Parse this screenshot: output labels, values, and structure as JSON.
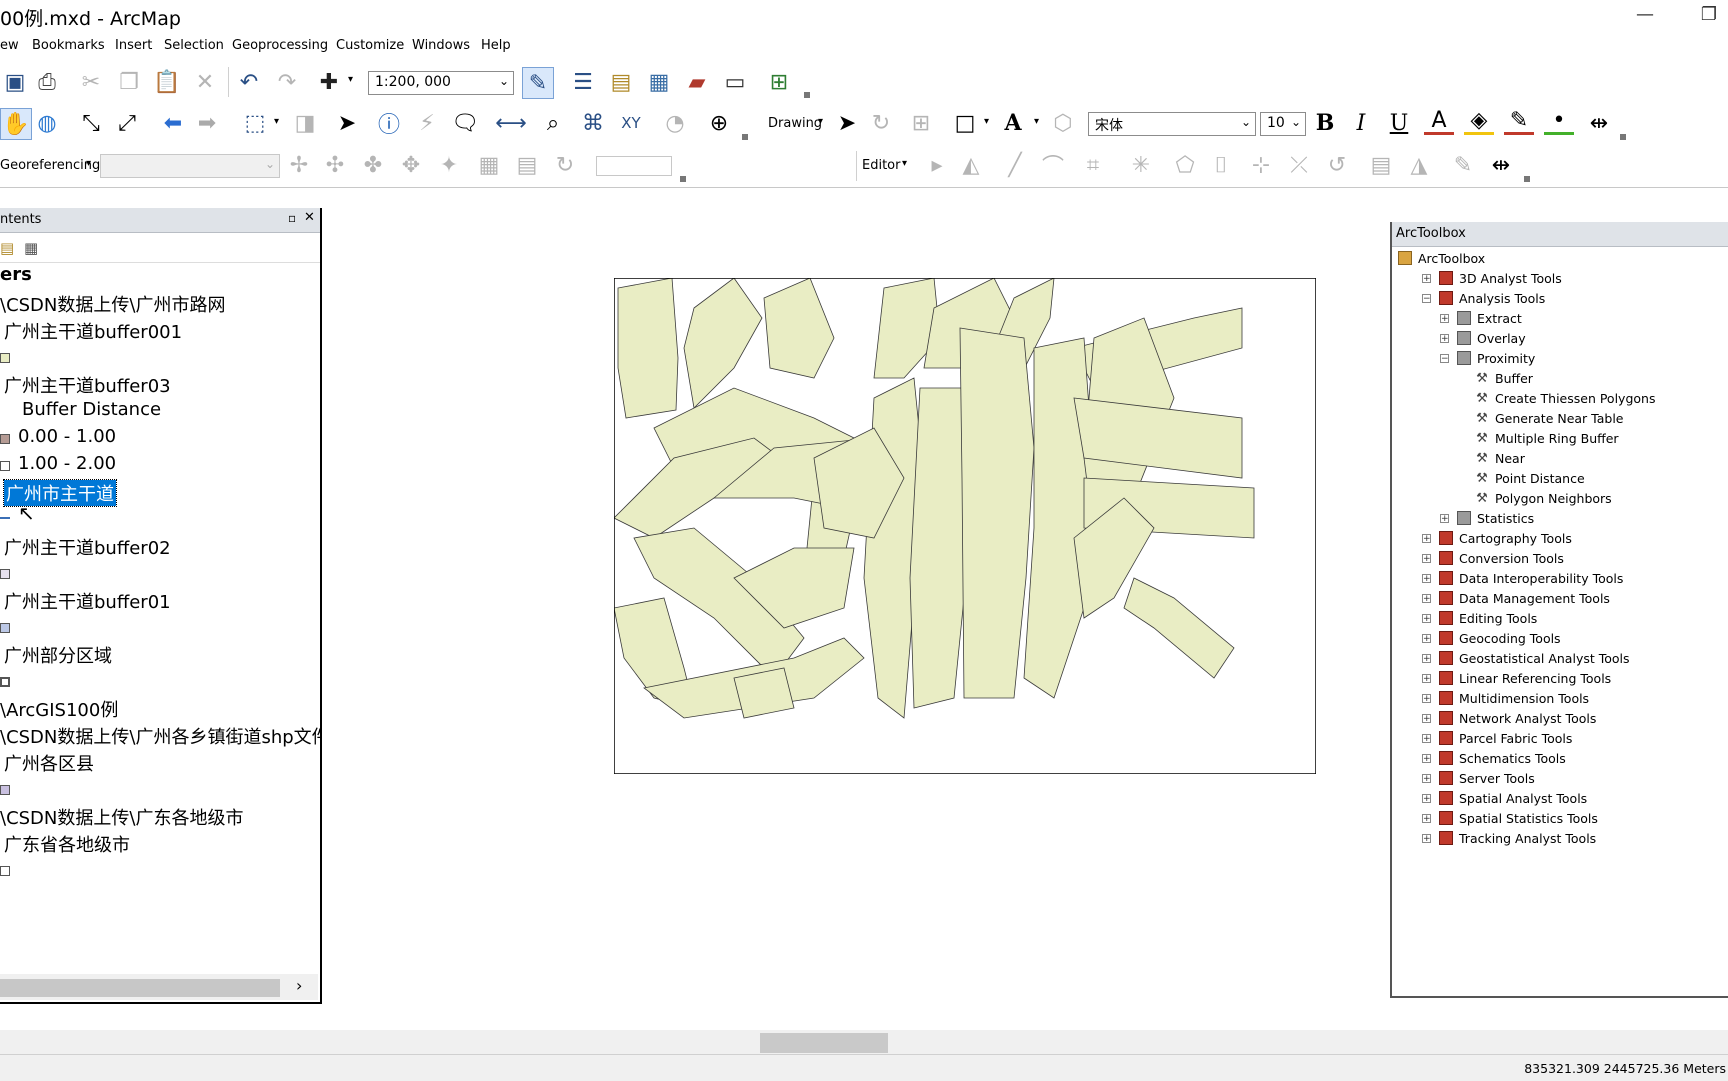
{
  "window": {
    "title": "00例.mxd - ArcMap",
    "minimize_glyph": "—",
    "restore_glyph": "❐"
  },
  "menu": [
    "ew",
    "Bookmarks",
    "Insert",
    "Selection",
    "Geoprocessing",
    "Customize",
    "Windows",
    "Help"
  ],
  "standard_toolbar": {
    "scale": "1:200, 000"
  },
  "draw_toolbar": {
    "drawing_label": "Drawing",
    "font_name": "宋体",
    "font_size": "10",
    "bold": "B",
    "italic": "I",
    "underline": "U"
  },
  "georef_toolbar": {
    "label": "Georeferencing",
    "editor_label": "Editor"
  },
  "toc": {
    "title": "ntents",
    "lines": [
      {
        "kind": "text",
        "text": "ers",
        "bold": true
      },
      {
        "kind": "text",
        "text": "\\CSDN数据上传\\广州市路网"
      },
      {
        "kind": "text",
        "text": "广州主干道buffer001",
        "indent": true
      },
      {
        "kind": "swatch",
        "color": "#e9edc4"
      },
      {
        "kind": "text",
        "text": "广州主干道buffer03",
        "indent": true
      },
      {
        "kind": "text",
        "text": "Buffer Distance",
        "indent2": true
      },
      {
        "kind": "legend",
        "text": "0.00 - 1.00",
        "color": "#b59b94"
      },
      {
        "kind": "legend",
        "text": "1.00 - 2.00",
        "color": "#ffffff"
      },
      {
        "kind": "selected",
        "text": "广州市主干道"
      },
      {
        "kind": "line",
        "color": "#3b6fb6"
      },
      {
        "kind": "text",
        "text": "广州主干道buffer02",
        "indent": true
      },
      {
        "kind": "swatch",
        "color": "#e7e1ef"
      },
      {
        "kind": "text",
        "text": "广州主干道buffer01",
        "indent": true
      },
      {
        "kind": "swatch",
        "color": "#bcc8e6"
      },
      {
        "kind": "text",
        "text": "广州部分区域",
        "indent": true
      },
      {
        "kind": "swatch",
        "color": "#ffffff",
        "thick": true
      },
      {
        "kind": "text",
        "text": "\\ArcGIS100例"
      },
      {
        "kind": "text",
        "text": "\\CSDN数据上传\\广州各乡镇街道shp文件"
      },
      {
        "kind": "text",
        "text": "广州各区县",
        "indent": true
      },
      {
        "kind": "swatch",
        "color": "#c9c0e0"
      },
      {
        "kind": "text",
        "text": "\\CSDN数据上传\\广东各地级市"
      },
      {
        "kind": "text",
        "text": "广东省各地级市",
        "indent": true
      },
      {
        "kind": "swatch",
        "color": "#ffffff"
      }
    ]
  },
  "toolbox": {
    "title": "ArcToolbox",
    "items": [
      {
        "label": "ArcToolbox",
        "level": 0,
        "icon": "folder",
        "exp": ""
      },
      {
        "label": "3D Analyst Tools",
        "level": 1,
        "icon": "box",
        "exp": "+"
      },
      {
        "label": "Analysis Tools",
        "level": 1,
        "icon": "box",
        "exp": "−"
      },
      {
        "label": "Extract",
        "level": 2,
        "icon": "set",
        "exp": "+"
      },
      {
        "label": "Overlay",
        "level": 2,
        "icon": "set",
        "exp": "+"
      },
      {
        "label": "Proximity",
        "level": 2,
        "icon": "set",
        "exp": "−"
      },
      {
        "label": "Buffer",
        "level": 3,
        "icon": "tool",
        "exp": ""
      },
      {
        "label": "Create Thiessen Polygons",
        "level": 3,
        "icon": "tool",
        "exp": ""
      },
      {
        "label": "Generate Near Table",
        "level": 3,
        "icon": "tool",
        "exp": ""
      },
      {
        "label": "Multiple Ring Buffer",
        "level": 3,
        "icon": "tool",
        "exp": ""
      },
      {
        "label": "Near",
        "level": 3,
        "icon": "tool",
        "exp": ""
      },
      {
        "label": "Point Distance",
        "level": 3,
        "icon": "tool",
        "exp": ""
      },
      {
        "label": "Polygon Neighbors",
        "level": 3,
        "icon": "tool",
        "exp": ""
      },
      {
        "label": "Statistics",
        "level": 2,
        "icon": "set",
        "exp": "+"
      },
      {
        "label": "Cartography Tools",
        "level": 1,
        "icon": "box",
        "exp": "+"
      },
      {
        "label": "Conversion Tools",
        "level": 1,
        "icon": "box",
        "exp": "+"
      },
      {
        "label": "Data Interoperability Tools",
        "level": 1,
        "icon": "box",
        "exp": "+"
      },
      {
        "label": "Data Management Tools",
        "level": 1,
        "icon": "box",
        "exp": "+"
      },
      {
        "label": "Editing Tools",
        "level": 1,
        "icon": "box",
        "exp": "+"
      },
      {
        "label": "Geocoding Tools",
        "level": 1,
        "icon": "box",
        "exp": "+"
      },
      {
        "label": "Geostatistical Analyst Tools",
        "level": 1,
        "icon": "box",
        "exp": "+"
      },
      {
        "label": "Linear Referencing Tools",
        "level": 1,
        "icon": "box",
        "exp": "+"
      },
      {
        "label": "Multidimension Tools",
        "level": 1,
        "icon": "box",
        "exp": "+"
      },
      {
        "label": "Network Analyst Tools",
        "level": 1,
        "icon": "box",
        "exp": "+"
      },
      {
        "label": "Parcel Fabric Tools",
        "level": 1,
        "icon": "box",
        "exp": "+"
      },
      {
        "label": "Schematics Tools",
        "level": 1,
        "icon": "box",
        "exp": "+"
      },
      {
        "label": "Server Tools",
        "level": 1,
        "icon": "box",
        "exp": "+"
      },
      {
        "label": "Spatial Analyst Tools",
        "level": 1,
        "icon": "box",
        "exp": "+"
      },
      {
        "label": "Spatial Statistics Tools",
        "level": 1,
        "icon": "box",
        "exp": "+"
      },
      {
        "label": "Tracking Analyst Tools",
        "level": 1,
        "icon": "box",
        "exp": "+"
      }
    ]
  },
  "status": {
    "coordinates": "835321.309  2445725.36 Meters"
  },
  "colors": {
    "buffer_fill": "#e9edc4",
    "selection": "#0078d7"
  }
}
